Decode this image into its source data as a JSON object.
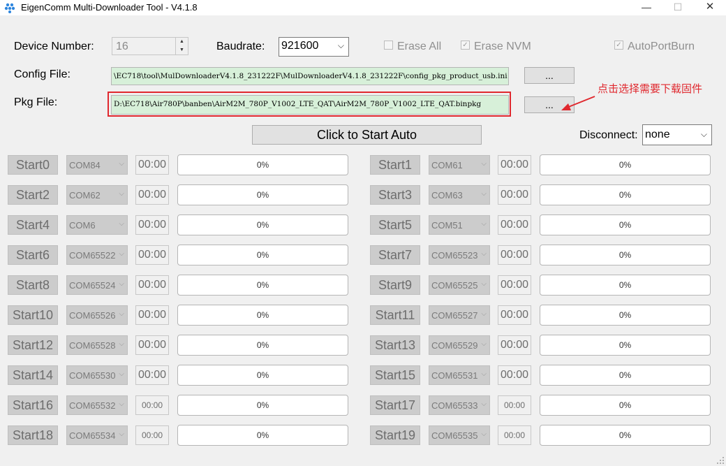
{
  "window": {
    "title": "EigenComm Multi-Downloader Tool - V4.1.8",
    "icon": "eigencomm-logo-icon",
    "minimize_glyph": "—",
    "maximize_glyph": "☐",
    "close_glyph": "✕"
  },
  "device": {
    "label": "Device Number:",
    "value": "16"
  },
  "baudrate": {
    "label": "Baudrate:",
    "value": "921600"
  },
  "options": [
    {
      "label": "Erase All",
      "checked": false
    },
    {
      "label": "Erase NVM",
      "checked": true
    },
    {
      "label": "AutoPortBurn",
      "checked": true
    }
  ],
  "config_file": {
    "label": "Config File:",
    "path": "\\EC718\\tool\\MulDownloaderV4.1.8_231222F\\MulDownloaderV4.1.8_231222F\\config_pkg_product_usb.ini",
    "browse_label": "..."
  },
  "pkg_file": {
    "label": "Pkg File:",
    "path": "D:\\EC718\\Air780P\\banben\\AirM2M_780P_V1002_LTE_QAT\\AirM2M_780P_V1002_LTE_QAT.binpkg",
    "browse_label": "..."
  },
  "annotation": {
    "text": "点击选择需要下载固件",
    "color": "#e0282e"
  },
  "start_auto_label": "Click to Start Auto",
  "disconnect": {
    "label": "Disconnect:",
    "value": "none"
  },
  "ports": [
    {
      "start": "Start0",
      "com": "COM84",
      "time": "00:00",
      "progress": "0%"
    },
    {
      "start": "Start1",
      "com": "COM61",
      "time": "00:00",
      "progress": "0%"
    },
    {
      "start": "Start2",
      "com": "COM62",
      "time": "00:00",
      "progress": "0%"
    },
    {
      "start": "Start3",
      "com": "COM63",
      "time": "00:00",
      "progress": "0%"
    },
    {
      "start": "Start4",
      "com": "COM6",
      "time": "00:00",
      "progress": "0%"
    },
    {
      "start": "Start5",
      "com": "COM51",
      "time": "00:00",
      "progress": "0%"
    },
    {
      "start": "Start6",
      "com": "COM65522",
      "time": "00:00",
      "progress": "0%"
    },
    {
      "start": "Start7",
      "com": "COM65523",
      "time": "00:00",
      "progress": "0%"
    },
    {
      "start": "Start8",
      "com": "COM65524",
      "time": "00:00",
      "progress": "0%"
    },
    {
      "start": "Start9",
      "com": "COM65525",
      "time": "00:00",
      "progress": "0%"
    },
    {
      "start": "Start10",
      "com": "COM65526",
      "time": "00:00",
      "progress": "0%"
    },
    {
      "start": "Start11",
      "com": "COM65527",
      "time": "00:00",
      "progress": "0%"
    },
    {
      "start": "Start12",
      "com": "COM65528",
      "time": "00:00",
      "progress": "0%"
    },
    {
      "start": "Start13",
      "com": "COM65529",
      "time": "00:00",
      "progress": "0%"
    },
    {
      "start": "Start14",
      "com": "COM65530",
      "time": "00:00",
      "progress": "0%"
    },
    {
      "start": "Start15",
      "com": "COM65531",
      "time": "00:00",
      "progress": "0%"
    },
    {
      "start": "Start16",
      "com": "COM65532",
      "time": "00:00",
      "progress": "0%"
    },
    {
      "start": "Start17",
      "com": "COM65533",
      "time": "00:00",
      "progress": "0%"
    },
    {
      "start": "Start18",
      "com": "COM65534",
      "time": "00:00",
      "progress": "0%"
    },
    {
      "start": "Start19",
      "com": "COM65535",
      "time": "00:00",
      "progress": "0%"
    }
  ]
}
